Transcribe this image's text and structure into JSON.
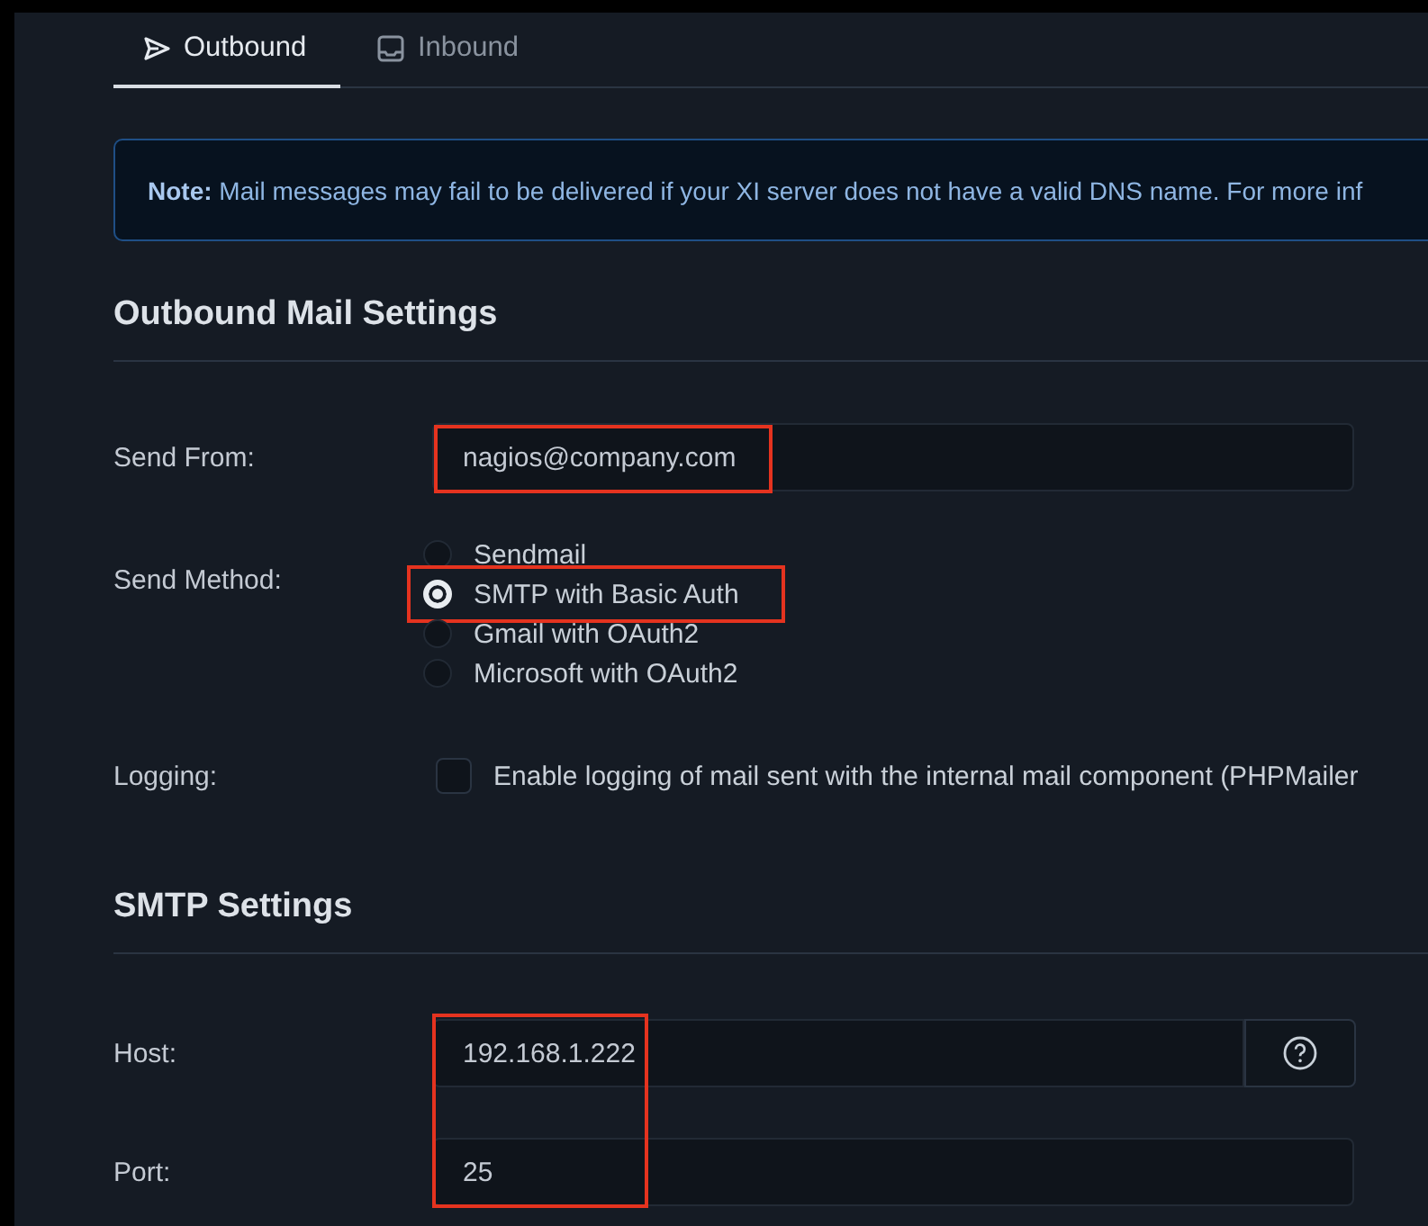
{
  "tabs": [
    {
      "label": "Outbound",
      "kind": "send",
      "selected": true
    },
    {
      "label": "Inbound",
      "kind": "inbox",
      "selected": false
    }
  ],
  "note": {
    "text": "**Note:** Mail messages may fail to be delivered if your XI server does not have a valid DNS name. For more inf"
  },
  "outbound": {
    "heading": "Outbound Mail Settings",
    "send_from": {
      "label": "Send From:",
      "value": "nagios@company.com",
      "highlighted": true
    },
    "send_method": {
      "label": "Send Method:",
      "options": [
        {
          "label": "Sendmail",
          "selected": false,
          "highlighted": false
        },
        {
          "label": "SMTP with Basic Auth",
          "selected": true,
          "highlighted": true
        },
        {
          "label": "Gmail with OAuth2",
          "selected": false,
          "highlighted": false
        },
        {
          "label": "Microsoft with OAuth2",
          "selected": false,
          "highlighted": false
        }
      ]
    },
    "logging": {
      "label": "Logging:",
      "checkbox_label": "Enable logging of mail sent with the internal mail component (PHPMailer",
      "checked": false
    }
  },
  "smtp": {
    "heading": "SMTP Settings",
    "highlighted": true,
    "host": {
      "label": "Host:",
      "value": "192.168.1.222"
    },
    "port": {
      "label": "Port:",
      "value": "25"
    }
  }
}
